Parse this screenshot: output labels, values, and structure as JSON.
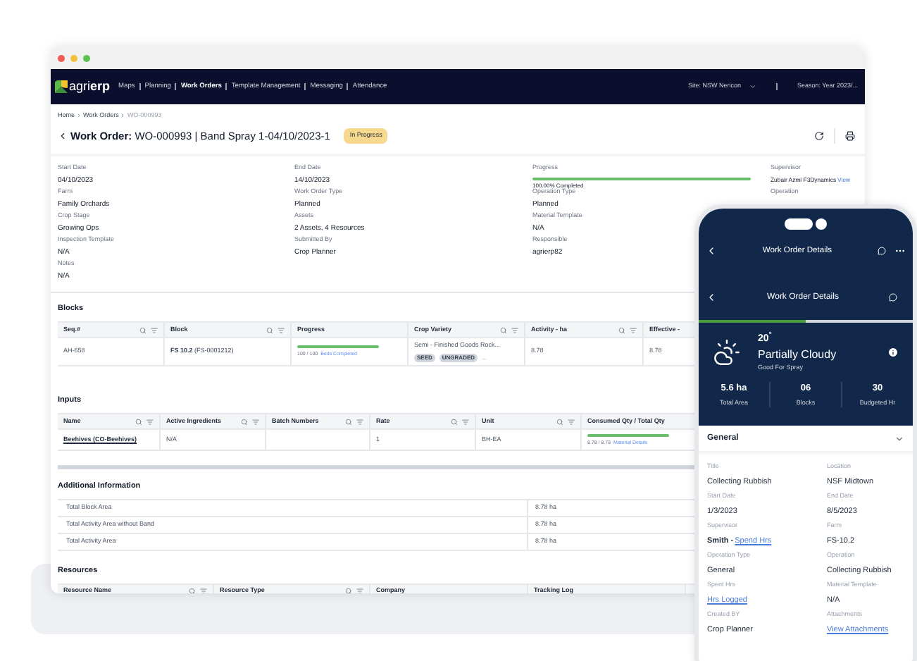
{
  "browser": {
    "nav": {
      "logo": "agri**erp**",
      "items": [
        {
          "label": "Maps",
          "selected": false
        },
        {
          "label": "Planning",
          "selected": false
        },
        {
          "label": "Work Orders",
          "selected": true
        },
        {
          "label": "Template Management",
          "selected": false
        },
        {
          "label": "Messaging",
          "selected": false
        },
        {
          "label": "Attendance",
          "selected": false
        }
      ],
      "site": "Site: NSW Nericon",
      "season": "Season: Year 2023/..."
    },
    "breadcrumb": [
      {
        "label": "Home",
        "current": false
      },
      {
        "label": "Work Orders",
        "current": false
      },
      {
        "label": "WO-000993",
        "current": true
      }
    ],
    "title": {
      "prefix": "Work Order:",
      "text": "WO-000993 | Band Spray 1-04/10/2023-1",
      "status": "In Progress"
    },
    "details": [
      [
        {
          "kind": "text",
          "label": "Start Date",
          "value": "04/10/2023"
        },
        {
          "kind": "text",
          "label": "End Date",
          "value": "14/10/2023"
        },
        {
          "kind": "progress",
          "label": "Progress",
          "level": 1,
          "value": "100.00% Completed"
        },
        {
          "kind": "link",
          "label": "Supervisor",
          "value": "Zubair Azmi F3Dynamics",
          "link": "View"
        }
      ],
      [
        {
          "kind": "text",
          "label": "Farm",
          "value": "Family Orchards"
        },
        {
          "kind": "text",
          "label": "Work Order Type",
          "value": "Planned"
        },
        {
          "kind": "text",
          "label": "Operation Type",
          "value": "Planned"
        },
        {
          "kind": "label",
          "label": "Operation"
        }
      ],
      [
        {
          "kind": "text",
          "label": "Crop Stage",
          "value": "Growing Ops"
        },
        {
          "kind": "text",
          "label": "Assets",
          "value": "2 Assets, 4 Resources"
        },
        {
          "kind": "text",
          "label": "Material Template",
          "value": "N/A"
        }
      ],
      [
        {
          "kind": "text",
          "label": "Inspection Template",
          "value": "N/A"
        },
        {
          "kind": "text",
          "label": "Submitted By",
          "value": "Crop Planner"
        },
        {
          "kind": "text",
          "label": "Responsible",
          "value": "agrierp82"
        }
      ],
      [
        {
          "kind": "text",
          "label": "Notes",
          "value": "N/A"
        }
      ]
    ],
    "blocks": {
      "title": "Blocks",
      "columns": [
        {
          "label": "Seq.#",
          "tools": true
        },
        {
          "label": "Block",
          "tools": true
        },
        {
          "label": "Progress",
          "tools": false
        },
        {
          "label": "Crop Variety",
          "tools": true
        },
        {
          "label": "Activity - ha",
          "tools": true
        },
        {
          "label": "Effective -",
          "tools": false
        }
      ],
      "rows": [
        [
          {
            "kind": "text",
            "text": "AH-658"
          },
          {
            "kind": "rich",
            "text": "**FS 10.2** (FS-0001212)"
          },
          {
            "kind": "progress",
            "level": 1,
            "text": "100 / 100",
            "link": "Beds Completed"
          },
          {
            "kind": "tags",
            "text": "Semi - Finished Goods Rock...",
            "tags": [
              "SEED",
              "UNGRADED"
            ],
            "more": "..."
          },
          {
            "kind": "text",
            "text": "8.78"
          },
          {
            "kind": "text",
            "text": "8.78"
          }
        ]
      ]
    },
    "inputs": {
      "title": "Inputs",
      "columns": [
        {
          "label": "Name",
          "tools": true
        },
        {
          "label": "Active Ingredients",
          "tools": true
        },
        {
          "label": "Batch Numbers",
          "tools": true
        },
        {
          "label": "Rate",
          "tools": true
        },
        {
          "label": "Unit",
          "tools": true
        },
        {
          "label": "Consumed Qty / Total Qty",
          "tools": false
        }
      ],
      "rows": [
        [
          {
            "kind": "link",
            "text": "Beehives (CO-Beehives)"
          },
          {
            "kind": "text",
            "text": "N/A"
          },
          {
            "kind": "empty"
          },
          {
            "kind": "text",
            "text": "1"
          },
          {
            "kind": "text",
            "text": "BH-EA"
          },
          {
            "kind": "progress",
            "level": 1,
            "text": "8.78 / 8.78",
            "link": "Material Details"
          }
        ]
      ]
    },
    "additional": {
      "title": "Additional Information",
      "rows": [
        {
          "label": "Total Block Area",
          "value": "8.78 ha"
        },
        {
          "label": "Total Activity Area without Band",
          "value": "8.78 ha"
        },
        {
          "label": "Total Activity Area",
          "value": "8.78 ha"
        }
      ]
    },
    "resources": {
      "title": "Resources",
      "columns": [
        {
          "label": "Resource Name",
          "tools": true
        },
        {
          "label": "Resource Type",
          "tools": true
        },
        {
          "label": "Company",
          "tools": false
        },
        {
          "label": "Tracking Log",
          "tools": false
        }
      ]
    }
  },
  "phone": {
    "header": "Work Order Details",
    "subheader": "Work Order Details",
    "progress": {
      "level": 0.5
    },
    "weather": {
      "temp": "20$^{°}$",
      "condition": "Partially Cloudy",
      "note": "Good For Spray"
    },
    "stats": [
      {
        "value": "5.6 ha",
        "label": "Total Area"
      },
      {
        "value": "06",
        "label": "Blocks"
      },
      {
        "value": "30",
        "label": "Budgeted Hr"
      }
    ],
    "section": "General",
    "fields": [
      {
        "kind": "text",
        "label": "Title",
        "value": "Collecting Rubbish"
      },
      {
        "kind": "text",
        "label": "Location",
        "value": "NSF Midtown"
      },
      {
        "kind": "text",
        "label": "Start Date",
        "value": "1/3/2023"
      },
      {
        "kind": "text",
        "label": "End Date",
        "value": "8/5/2023"
      },
      {
        "kind": "link",
        "label": "Supervisor",
        "value": "Smith -",
        "link": "Spend Hrs"
      },
      {
        "kind": "text",
        "label": "Farm",
        "value": "FS-10.2"
      },
      {
        "kind": "text",
        "label": "Operation Type",
        "value": "General"
      },
      {
        "kind": "text",
        "label": "Operation",
        "value": "Collecting Rubbish"
      },
      {
        "kind": "link",
        "label": "Spent Hrs",
        "link": "Hrs Logged"
      },
      {
        "kind": "text",
        "label": "Material Template",
        "value": "N/A"
      },
      {
        "kind": "text",
        "label": "Created BY",
        "value": "Crop Planner"
      },
      {
        "kind": "link",
        "label": "Attachments",
        "link": "View Attachments"
      }
    ]
  }
}
